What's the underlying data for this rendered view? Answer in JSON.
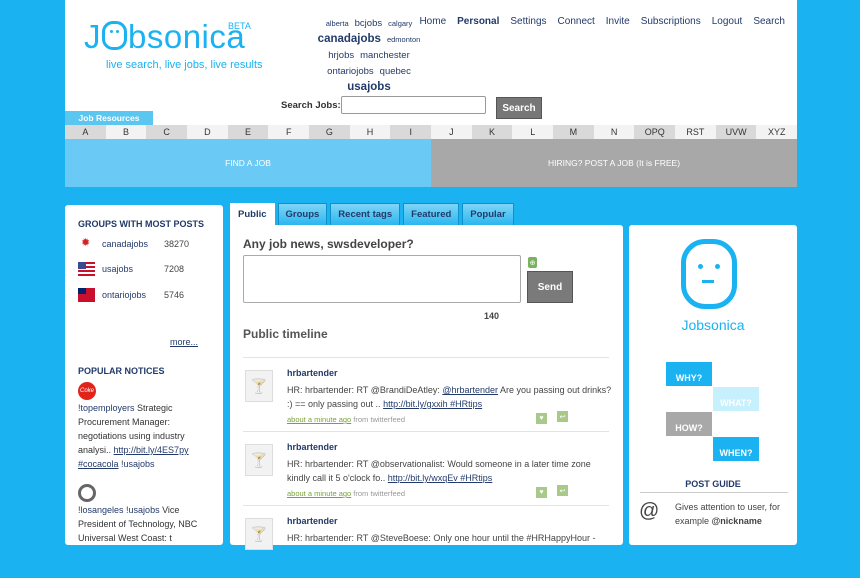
{
  "header": {
    "logo": "Jobsonica",
    "beta": "BETA",
    "tagline": "live search, live jobs, live results",
    "cities": [
      "alberta",
      "bcjobs",
      "calgary",
      "canadajobs",
      "edmonton",
      "hrjobs",
      "manchester",
      "ontariojobs",
      "quebec",
      "usajobs"
    ],
    "nav": [
      "Home",
      "Personal",
      "Settings",
      "Connect",
      "Invite",
      "Subscriptions",
      "Logout",
      "Search"
    ],
    "search_label": "Search Jobs:",
    "search_button": "Search",
    "job_resources": "Job Resources",
    "alphabet": [
      "A",
      "B",
      "C",
      "D",
      "E",
      "F",
      "G",
      "H",
      "I",
      "J",
      "K",
      "L",
      "M",
      "N",
      "OPQ",
      "RST",
      "UVW",
      "XYZ"
    ],
    "find_job": "FIND A JOB",
    "hiring": "HIRING? POST A JOB (It is FREE)"
  },
  "sidebar": {
    "groups_title": "GROUPS WITH MOST POSTS",
    "groups": [
      {
        "name": "canadajobs",
        "count": "38270"
      },
      {
        "name": "usajobs",
        "count": "7208"
      },
      {
        "name": "ontariojobs",
        "count": "5746"
      }
    ],
    "more": "more...",
    "popular_title": "POPULAR NOTICES",
    "popular": [
      {
        "tag": "!topemployers",
        "text": " Strategic Procurement Manager: negotiations using industry analysi.. ",
        "url": "http://bit.ly/4ES7py",
        "hash": "#cocacola",
        "group": " !usajobs"
      },
      {
        "tag": "!losangeles",
        "tag2": " !usajobs",
        "text": " Vice President of Technology, NBC Universal West Coast: t"
      }
    ]
  },
  "tabs": [
    "Public",
    "Groups",
    "Recent tags",
    "Featured",
    "Popular"
  ],
  "main": {
    "ask": "Any job news, swsdeveloper?",
    "send": "Send",
    "char_count": "140",
    "timeline_title": "Public timeline",
    "notices": [
      {
        "author": "hrbartender",
        "p1": "HR: hrbartender: RT @BrandiDeAtley: ",
        "mention": "@hrbartender",
        "p2": " Are you passing out drinks? :) == only passing out .. ",
        "link": "http://bit.ly/gxxih",
        "hash": " #HRtips",
        "time": "about a minute ago",
        "source": " from twitterfeed"
      },
      {
        "author": "hrbartender",
        "p1": "HR: hrbartender: RT @observationalist: Would someone in a later time zone kindly call it 5 o'clock fo.. ",
        "link": "http://bit.ly/wxqEv",
        "hash": " #HRtips",
        "time": "about a minute ago",
        "source": " from twitterfeed"
      },
      {
        "author": "hrbartender",
        "p1": "HR: hrbartender: RT @SteveBoese: Only one hour until the #HRHappyHour -"
      }
    ]
  },
  "right": {
    "brand": "Jobsonica",
    "q": [
      "WHY?",
      "WHAT?",
      "HOW?",
      "WHEN?"
    ],
    "post_guide": "POST GUIDE",
    "guide_symbol": "@",
    "guide_text": "Gives attention to user, for example ",
    "guide_example": "@nickname"
  },
  "colors": {
    "background": "#1ab2f0",
    "find_job_bg": "#6ac9f5",
    "hiring_bg": "#a8a8a8",
    "link": "#223a6a",
    "q_why": "#1ab2f0",
    "q_what": "#c6f0fb",
    "q_how": "#a8a8a8",
    "q_when": "#1ab2f0"
  }
}
